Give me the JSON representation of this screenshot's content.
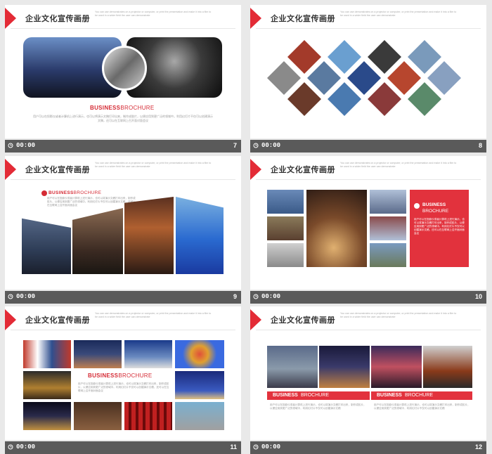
{
  "slides": [
    {
      "title": "企业文化宣传画册",
      "subtitle": "You can use demonstrates on a projector or computer, or print the presentation and make it into a film to be used in a wider field the user can demonstrate",
      "time": "00:00",
      "page": "7"
    },
    {
      "title": "",
      "subtitle": "You can use demonstrates on a projector or computer, or print the presentation and make it into a film to be used in a wider field the user can demonstrate",
      "time": "00:00",
      "page": "8"
    },
    {
      "title": "企业文化宣传画册",
      "subtitle": "You can use demonstrates on a projector or computer, or print the presentation and make it into a film to be used in a wider field the user can demonstrate",
      "time": "00:00",
      "page": "9"
    },
    {
      "title": "企业文化宣传画册",
      "subtitle": "You can use demonstrates on a projector or computer, or print the presentation and make it into a film to be used in a wider field the user can demonstrate",
      "time": "00:00",
      "page": "10"
    },
    {
      "title": "企业文化宣传画册",
      "subtitle": "You can use demonstrates on a projector or computer, or print the presentation and make it into a film to be used in a wider field the user can demonstrate",
      "time": "00:00",
      "page": "11"
    },
    {
      "title": "企业文化宣传画册",
      "subtitle": "You can use demonstrates on a projector or computer, or print the presentation and make it into a film to be used in a wider field the user can demonstrate",
      "time": "00:00",
      "page": "12"
    }
  ],
  "brand": {
    "bold": "BUSINESS",
    "light": "BROCHURE"
  },
  "body": {
    "para": "用户可以在投影仪或者计算机上进行演示，也可以将演示文稿打印出来，制作成胶片，以便应用到更广泛的领域中。利用幻灯片不仅可以创建演示文稿，还可以在互联网上召开面对面会议",
    "short": "用户可以在投影仪或者计算机上进行演示，也可以将演示文稿打印出来，制作成胶片，以便应用到更广泛的领域中，利用幻灯片不仅可以创建演示文稿"
  },
  "colors": {
    "accent": "#e2323d",
    "bar": "#5a5a5a"
  }
}
